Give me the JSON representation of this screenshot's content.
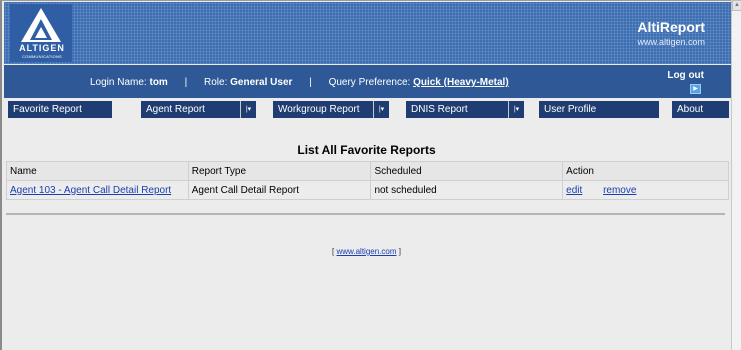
{
  "header": {
    "logo_text": "ALTIGEN",
    "logo_subtext": "COMMUNICATIONS",
    "app_title": "AltiReport",
    "app_url": "www.altigen.com"
  },
  "userbar": {
    "login_label": "Login Name:",
    "login_value": "tom",
    "role_label": "Role:",
    "role_value": "General User",
    "query_label": "Query Preference:",
    "query_value": "Quick (Heavy-Metal)",
    "separator": "|",
    "logout_label": "Log out",
    "logout_icon": "right-arrow-icon"
  },
  "menu": {
    "items": [
      {
        "label": "Favorite Report",
        "dropdown": false
      },
      {
        "label": "Agent Report",
        "dropdown": true
      },
      {
        "label": "Workgroup Report",
        "dropdown": true
      },
      {
        "label": "DNIS Report",
        "dropdown": true
      },
      {
        "label": "User Profile",
        "dropdown": false
      },
      {
        "label": "About",
        "dropdown": false
      }
    ],
    "dropdown_glyph": "|▾"
  },
  "main": {
    "heading": "List All Favorite Reports",
    "columns": [
      "Name",
      "Report Type",
      "Scheduled",
      "Action"
    ],
    "rows": [
      {
        "name": "Agent 103 - Agent Call Detail Report",
        "report_type": "Agent Call Detail Report",
        "scheduled": "not scheduled",
        "actions": [
          "edit",
          "remove"
        ]
      }
    ]
  },
  "footer": {
    "open_bracket": "[",
    "link": "www.altigen.com",
    "close_bracket": "]"
  },
  "colors": {
    "banner": "#3a6db2",
    "userbar": "#2e5996",
    "menu": "#1f3d72",
    "link": "#1a3fb0",
    "background": "#ececec"
  }
}
